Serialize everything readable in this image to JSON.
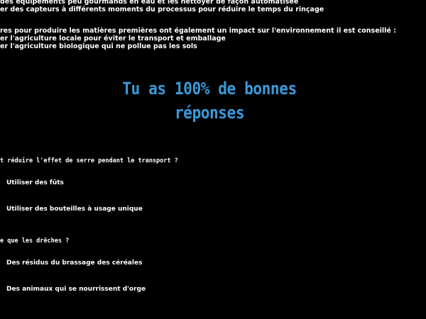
{
  "info": {
    "line1": "des équipements peu gourmands en eau et les nettoyer de façon automatisée",
    "line2": "er des capteurs à différents moments du processus pour réduire le temps du rinçage",
    "line3": "res pour produire les matières premières ont également un impact sur l'environnement il est conseillé :",
    "line4": "er l'agriculture locale pour éviter le transport et emballage",
    "line5": "er l'agriculture biologique qui ne pollue pas les sols"
  },
  "result": {
    "line1": "Tu as 100%  de bonnes",
    "line2": "réponses",
    "color": "#3a9ad9"
  },
  "questions": [
    {
      "text": "t réduire l'effet de serre pendant le transport ?",
      "options": [
        "Utiliser des fûts",
        "Utiliser des bouteilles à usage unique"
      ]
    },
    {
      "text": "e que les drêches ?",
      "options": [
        "Des résidus du brassage des céréales",
        "Des animaux qui se nourrissent d'orge"
      ]
    }
  ]
}
